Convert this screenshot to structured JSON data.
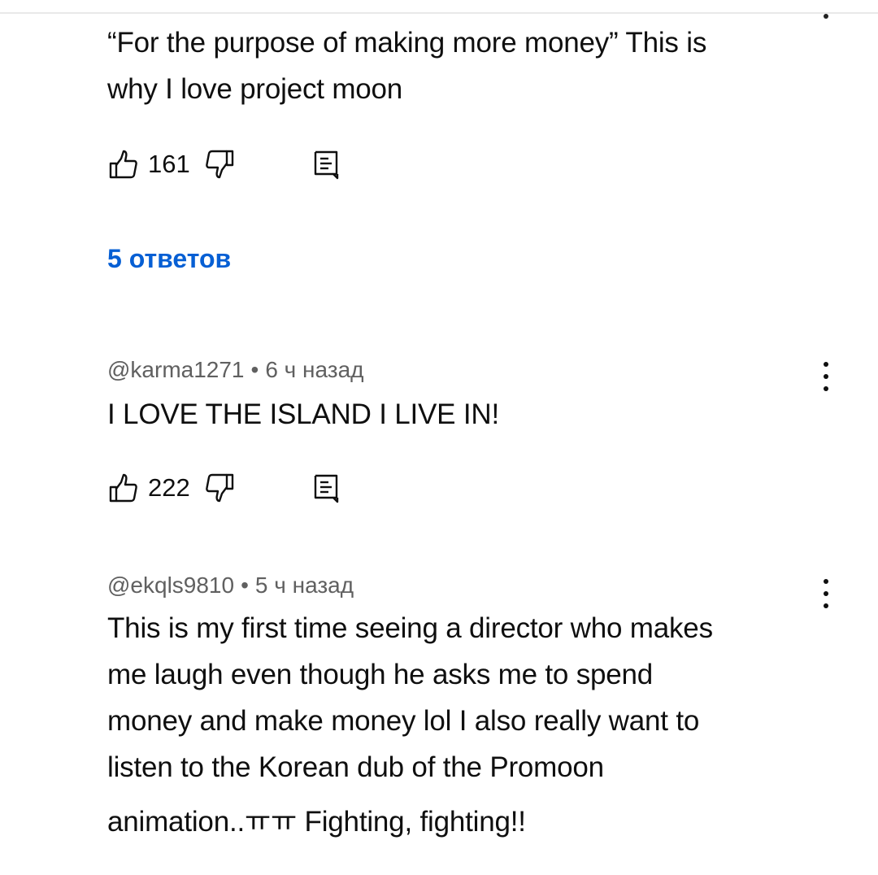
{
  "comments": [
    {
      "text_lines": [
        "“For the purpose of making more money” This is",
        "why I love project moon"
      ],
      "likes": "161"
    },
    {
      "author": "@karma1271",
      "time": "6 ч назад",
      "text_lines": [
        "I LOVE THE ISLAND I LIVE IN!"
      ],
      "likes": "222"
    },
    {
      "author": "@ekqls9810",
      "time": "5 ч назад",
      "text_lines": [
        "This is my first time seeing a director who makes",
        "me laugh even though he asks me to spend",
        "money and make money lol I also really want to",
        "listen to the Korean dub of the Promoon",
        "animation..ㅠㅠ Fighting, fighting!!"
      ]
    }
  ],
  "replies_link": "5 ответов",
  "meta_separator": "•",
  "icons": {
    "like": "thumbs-up-icon",
    "dislike": "thumbs-down-icon",
    "reply": "comment-reply-icon",
    "more": "more-vertical-icon"
  },
  "colors": {
    "text": "#0f0f0f",
    "secondary": "#606060",
    "link": "#065fd4",
    "background": "#ffffff"
  }
}
